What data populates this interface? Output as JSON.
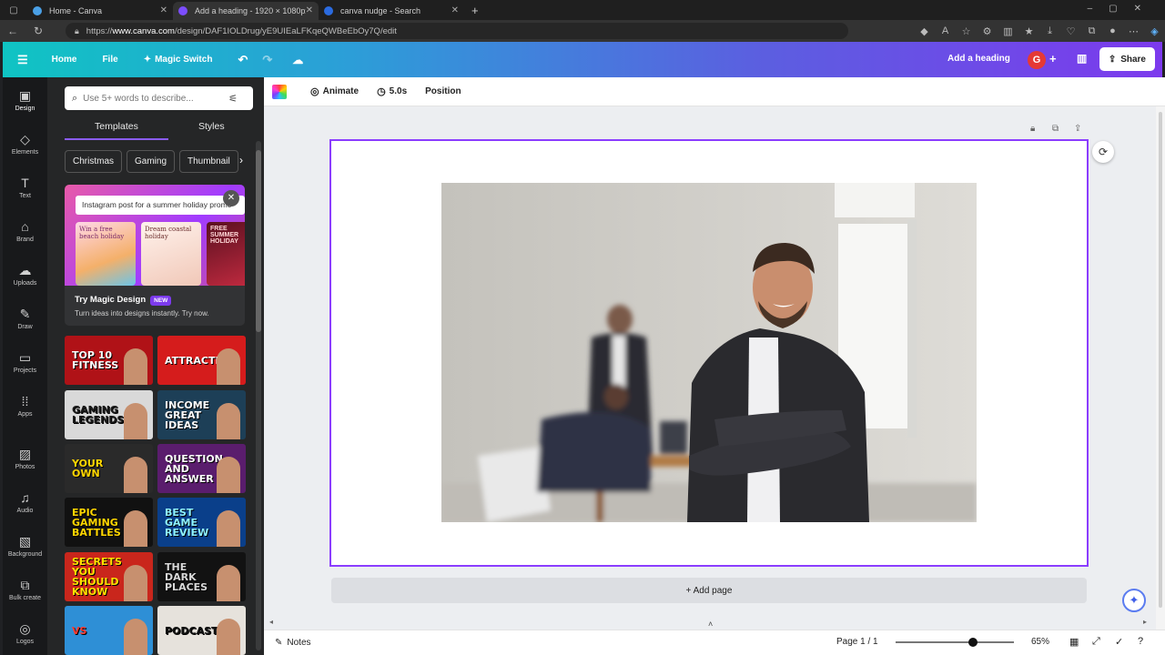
{
  "browser": {
    "tabs": [
      {
        "title": "Home - Canva",
        "fav_color": "#4aa0e6"
      },
      {
        "title": "Add a heading - 1920 × 1080px",
        "fav_color": "#7c4dff"
      },
      {
        "title": "canva nudge - Search",
        "fav_color": "#2b6be0"
      }
    ],
    "url_prefix": "https://",
    "url_host": "www.canva.com",
    "url_path": "/design/DAF1IOLDrug/yE9UIEaLFKqeQWBeEbOy7Q/edit"
  },
  "header": {
    "home": "Home",
    "file": "File",
    "magic_switch": "Magic Switch",
    "doc_title": "Add a heading",
    "avatar_letter": "G",
    "share": "Share"
  },
  "rail": [
    {
      "label": "Design",
      "icon": "design-icon",
      "glyph": "▣"
    },
    {
      "label": "Elements",
      "icon": "elements-icon",
      "glyph": "◇"
    },
    {
      "label": "Text",
      "icon": "text-icon",
      "glyph": "T"
    },
    {
      "label": "Brand",
      "icon": "brand-icon",
      "glyph": "⌂"
    },
    {
      "label": "Uploads",
      "icon": "uploads-icon",
      "glyph": "☁"
    },
    {
      "label": "Draw",
      "icon": "draw-icon",
      "glyph": "✎"
    },
    {
      "label": "Projects",
      "icon": "projects-icon",
      "glyph": "▭"
    },
    {
      "label": "Apps",
      "icon": "apps-icon",
      "glyph": "⁞⁞"
    },
    {
      "label": "Photos",
      "icon": "photos-icon",
      "glyph": "▨"
    },
    {
      "label": "Audio",
      "icon": "audio-icon",
      "glyph": "♫"
    },
    {
      "label": "Background",
      "icon": "background-icon",
      "glyph": "▧"
    },
    {
      "label": "Bulk create",
      "icon": "bulk-create-icon",
      "glyph": "⧉"
    },
    {
      "label": "Logos",
      "icon": "logos-icon",
      "glyph": "◎"
    }
  ],
  "panel": {
    "search_placeholder": "Use 5+ words to describe...",
    "tab_templates": "Templates",
    "tab_styles": "Styles",
    "chips": [
      "Christmas",
      "Gaming",
      "Thumbnail"
    ],
    "promo_prompt": "Instagram post for a summer holiday promo",
    "promo_title": "Try Magic Design",
    "promo_badge": "NEW",
    "promo_sub": "Turn ideas into designs instantly. Try now.",
    "promo_cards": [
      "Win a free beach holiday",
      "Dream coastal holiday",
      "FREE SUMMER HOLIDAY"
    ],
    "thumbnails": [
      {
        "text": "TOP 10 FITNESS",
        "bg": "#b01217",
        "fg": "#ffffff"
      },
      {
        "text": "ATTRACTIVE",
        "bg": "#d51c1c",
        "fg": "#ffffff"
      },
      {
        "text": "GAMING LEGENDS",
        "bg": "#d9d9d9",
        "fg": "#1a1a1a"
      },
      {
        "text": "INCOME GREAT IDEAS",
        "bg": "#1d3f57",
        "fg": "#ffffff"
      },
      {
        "text": "YOUR OWN",
        "bg": "#2a2a2a",
        "fg": "#ffd600"
      },
      {
        "text": "QUESTION AND ANSWER",
        "bg": "#5a1d6d",
        "fg": "#ffffff"
      },
      {
        "text": "EPIC GAMING BATTLES",
        "bg": "#111111",
        "fg": "#ffd600"
      },
      {
        "text": "BEST GAME REVIEW",
        "bg": "#0a3f8a",
        "fg": "#8ef3ff"
      },
      {
        "text": "SECRETS YOU SHOULD KNOW",
        "bg": "#c9261c",
        "fg": "#ffe100"
      },
      {
        "text": "THE DARK PLACES",
        "bg": "#121212",
        "fg": "#d8d8d8"
      },
      {
        "text": "VS",
        "bg": "#2e8fd6",
        "fg": "#ff3b30"
      },
      {
        "text": "PODCAST",
        "bg": "#e6e2dc",
        "fg": "#111111"
      }
    ]
  },
  "toolbar": {
    "animate": "Animate",
    "duration": "5.0s",
    "position": "Position"
  },
  "canvas": {
    "add_page": "+ Add page"
  },
  "footer": {
    "notes": "Notes",
    "page": "Page 1 / 1",
    "zoom": "65%",
    "zoom_level": 0.65
  }
}
